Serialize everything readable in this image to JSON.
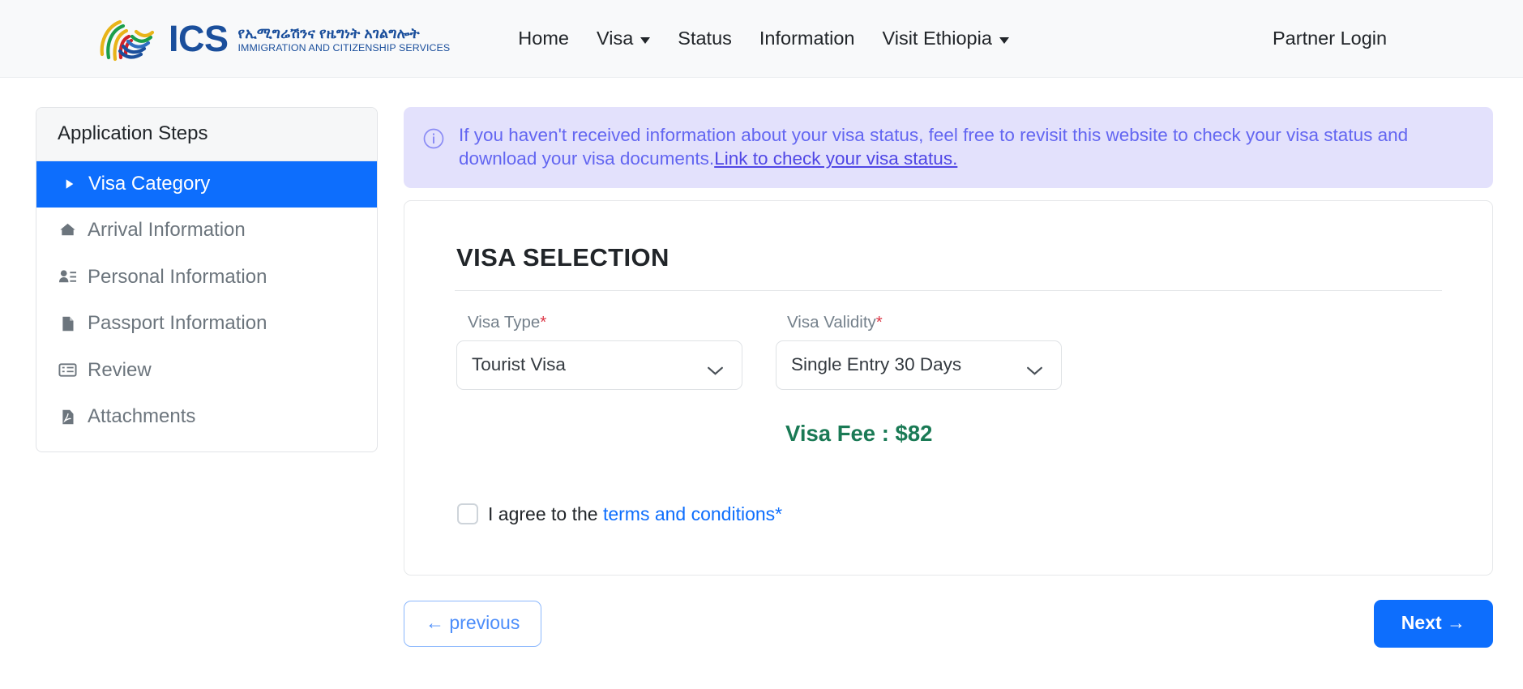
{
  "header": {
    "logo_icon": "fingerprint-logo-icon",
    "brand_abbrev": "ICS",
    "brand_amharic": "የኢሚግሬሽንና የዜግነት አገልግሎት",
    "brand_english": "IMMIGRATION AND CITIZENSHIP SERVICES",
    "nav": [
      {
        "label": "Home",
        "has_caret": false
      },
      {
        "label": "Visa",
        "has_caret": true
      },
      {
        "label": "Status",
        "has_caret": false
      },
      {
        "label": "Information",
        "has_caret": false
      },
      {
        "label": "Visit Ethiopia",
        "has_caret": true
      }
    ],
    "partner_login": "Partner Login"
  },
  "sidebar": {
    "title": "Application Steps",
    "items": [
      {
        "label": "Visa Category",
        "icon": "play-triangle-icon",
        "active": true
      },
      {
        "label": "Arrival Information",
        "icon": "home-icon",
        "active": false
      },
      {
        "label": "Personal Information",
        "icon": "person-details-icon",
        "active": false
      },
      {
        "label": "Passport Information",
        "icon": "document-icon",
        "active": false
      },
      {
        "label": "Review",
        "icon": "list-card-icon",
        "active": false
      },
      {
        "label": "Attachments",
        "icon": "pdf-file-icon",
        "active": false
      }
    ]
  },
  "alert": {
    "icon": "info-circle-icon",
    "text": "If you haven't received information about your visa status, feel free to revisit this website to check your visa status and download your visa documents.",
    "link_text": "Link to check your visa status."
  },
  "form": {
    "title": "VISA SELECTION",
    "visa_type": {
      "label": "Visa Type",
      "required_marker": "*",
      "value": "Tourist Visa",
      "chevron_icon": "chevron-down-icon"
    },
    "visa_validity": {
      "label": "Visa Validity",
      "required_marker": "*",
      "value": "Single Entry 30 Days",
      "chevron_icon": "chevron-down-icon"
    },
    "fee_text": "Visa Fee : $82",
    "fee_amount": "$82",
    "agree_prefix": "I agree to the ",
    "agree_link": "terms and conditions",
    "agree_required_marker": "*",
    "checkbox_checked": false
  },
  "actions": {
    "previous_label": "← previous",
    "next_label": "Next →"
  },
  "colors": {
    "accent_blue": "#0d6efd",
    "alert_bg": "#e3e1fc",
    "alert_text": "#6366f1",
    "fee_green": "#1a7a55",
    "brand_blue": "#1b4f9c",
    "required_red": "#dc3545"
  }
}
